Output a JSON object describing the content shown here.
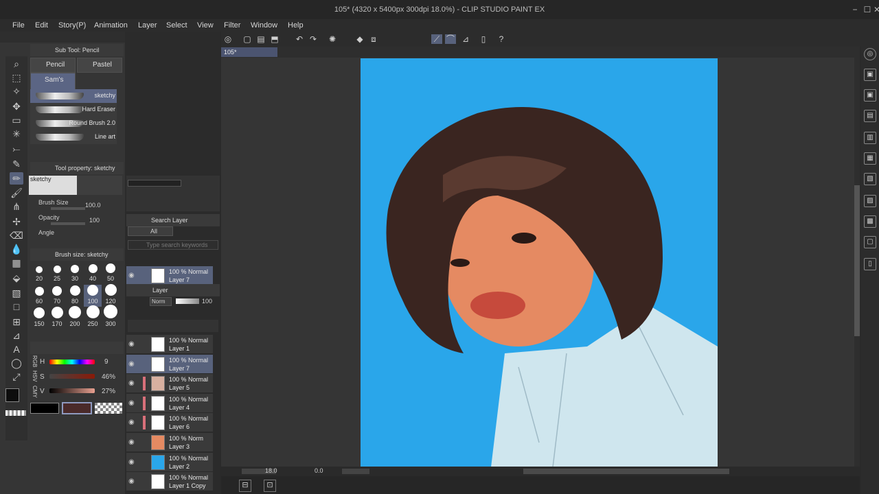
{
  "window": {
    "title": "105* (4320 x 5400px 300dpi 18.0%) - CLIP STUDIO PAINT EX",
    "minimize": "−",
    "maximize": "☐",
    "close": "✕"
  },
  "menu": [
    "File",
    "Edit",
    "Story(P)",
    "Animation",
    "Layer",
    "Select",
    "View",
    "Filter",
    "Window",
    "Help"
  ],
  "canvas_tab": {
    "label": "105*"
  },
  "subtool": {
    "header": "Sub Tool: Pencil",
    "tabs": [
      "Pencil",
      "Pastel",
      "Sam's Bru"
    ],
    "brushes": [
      "sketchy",
      "Hard Eraser",
      "Round Brush 2.0",
      "Line art"
    ]
  },
  "tool_property": {
    "header": "Tool property: sketchy",
    "brush_label": "sketchy",
    "brush_size_label": "Brush Size",
    "brush_size_value": "100.0",
    "opacity_label": "Opacity",
    "opacity_value": "100",
    "angle_label": "Angle"
  },
  "brush_size": {
    "header": "Brush size: sketchy",
    "sizes": [
      "20",
      "25",
      "30",
      "40",
      "50",
      "60",
      "70",
      "80",
      "100",
      "120",
      "150",
      "170",
      "200",
      "250",
      "300"
    ]
  },
  "color": {
    "h_label": "H",
    "h_value": "9",
    "s_label": "S",
    "s_value": "46%",
    "v_label": "V",
    "v_value": "27%",
    "hsv": "HSV",
    "rgb": "RGB",
    "cmy": "CMY",
    "main": "#0d0d0d",
    "sub": "#5a3030",
    "accent": "#58627c"
  },
  "search_layer": {
    "header": "Search Layer",
    "filter": "All",
    "placeholder": "Type search keywords",
    "result_opacity": "100 % Normal",
    "result_name": "Layer 7"
  },
  "layer_panel": {
    "header": "Layer",
    "blend": "Norm",
    "opacity": "100",
    "layers": [
      {
        "opacity": "100 % Normal",
        "name": "Layer 1"
      },
      {
        "opacity": "100 % Normal",
        "name": "Layer 7"
      },
      {
        "opacity": "100 % Normal",
        "name": "Layer 5"
      },
      {
        "opacity": "100 % Normal",
        "name": "Layer 4"
      },
      {
        "opacity": "100 % Normal",
        "name": "Layer 6"
      },
      {
        "opacity": "100 % Norm",
        "name": "Layer 3"
      },
      {
        "opacity": "100 % Normal",
        "name": "Layer 2"
      },
      {
        "opacity": "100 % Normal",
        "name": "Layer 1 Copy"
      }
    ]
  },
  "status": {
    "zoom": "18.0",
    "rotation": "0.0"
  }
}
